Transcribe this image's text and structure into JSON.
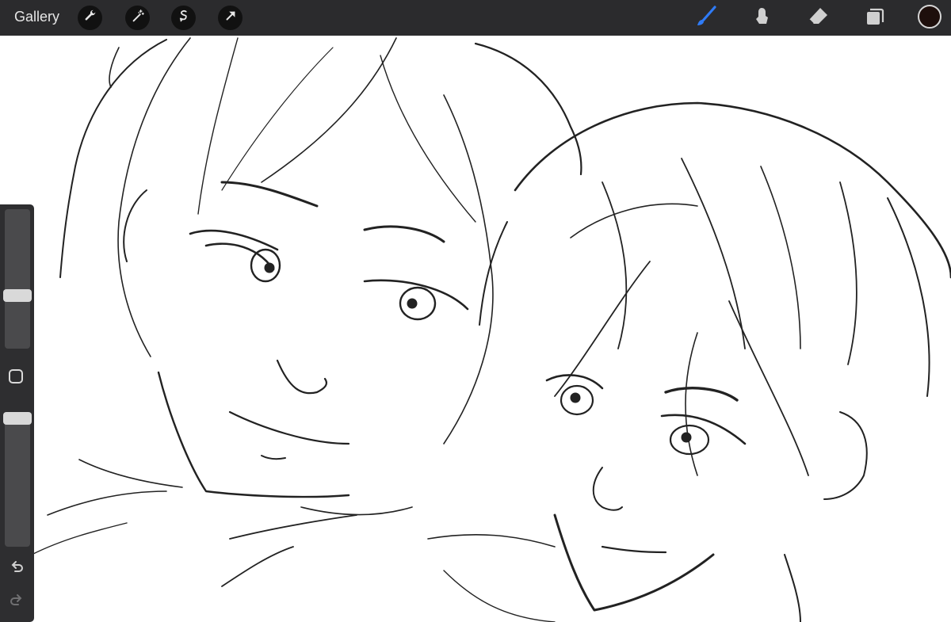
{
  "app": {
    "gallery_label": "Gallery"
  },
  "toolbar": {
    "left_tools": [
      "wrench-icon",
      "magic-wand-icon",
      "selection-icon",
      "transform-arrow-icon"
    ],
    "right_tools": [
      "brush-icon",
      "smudge-icon",
      "eraser-icon",
      "layers-icon"
    ],
    "active_tool": "brush-icon",
    "active_tool_color": "#2f7bf6",
    "current_color": "#1e0f0c"
  },
  "sidebar": {
    "brush_size_level": 0.63,
    "opacity_level": 1.0,
    "undo_icon": "undo-icon",
    "redo_icon": "redo-icon"
  },
  "canvas": {
    "artwork": "line-art-sketch"
  }
}
